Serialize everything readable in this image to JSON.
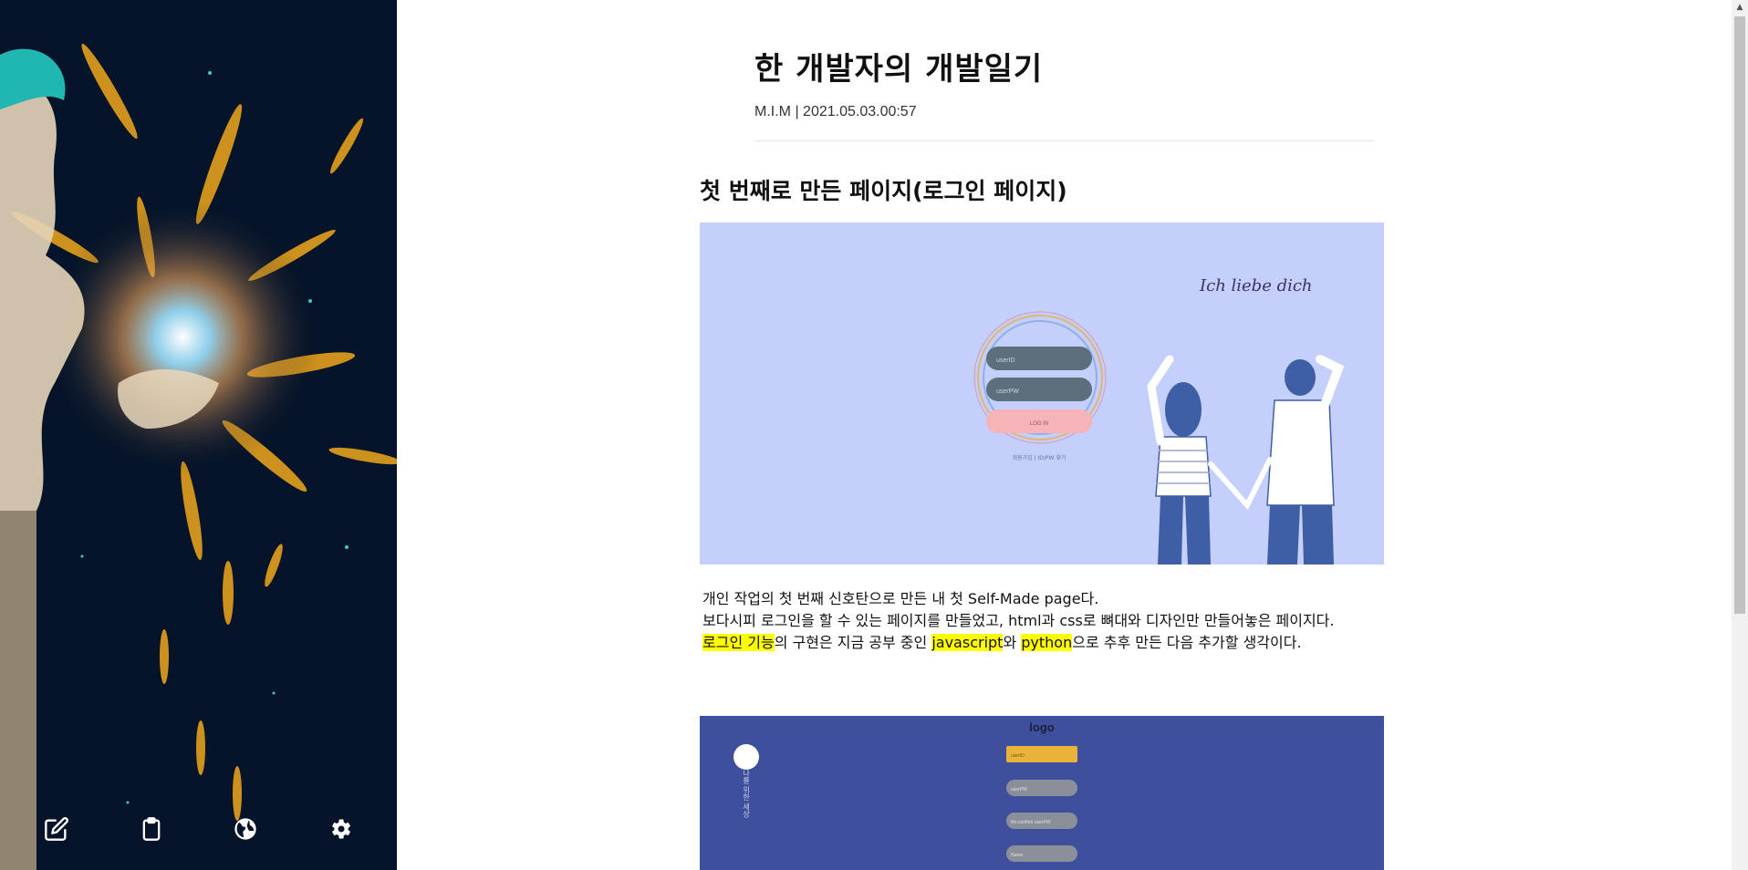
{
  "sidebar": {
    "toolbar": {
      "write_icon": "edit-icon",
      "clipboard_icon": "clipboard-icon",
      "globe_icon": "globe-icon",
      "settings_icon": "settings-gear-icon"
    }
  },
  "post": {
    "title": "한 개발자의 개발일기",
    "meta": "M.I.M | 2021.05.03.00:57",
    "section_title": "첫 번째로 만든 페이지(로그인 페이지)",
    "figure1": {
      "script_text": "Ich liebe dich",
      "id_placeholder": "userID",
      "pw_placeholder": "userPW",
      "login_button": "LOG IN",
      "links": "회원가입 | ID/PW 찾기"
    },
    "body": {
      "line1": "개인 작업의 첫 번째 신호탄으로 만든 내 첫 Self-Made page다.",
      "line2": "보다시피 로그인을 할 수 있는 페이지를 만들었고, html과 css로 뼈대와 디자인만 만들어놓은 페이지다.",
      "line3_hl1": "로그인 기능",
      "line3_t1": "의 구현은 지금 공부 중인 ",
      "line3_hl2": "javascript",
      "line3_t2": "와 ",
      "line3_hl3": "python",
      "line3_t3": "으로 추후 만든 다음 추가할 생각이다."
    },
    "figure2": {
      "logo": "logo",
      "side_text": "나를 위한 세상",
      "field1": "userID",
      "field2": "userPW",
      "field3": "Re-confirm userPW",
      "field4": "Name"
    }
  },
  "colors": {
    "sidebar_bg": "#06142a",
    "figure1_bg": "#c4cffb",
    "figure2_bg": "#3e4f9e",
    "highlight": "#ffff00"
  }
}
